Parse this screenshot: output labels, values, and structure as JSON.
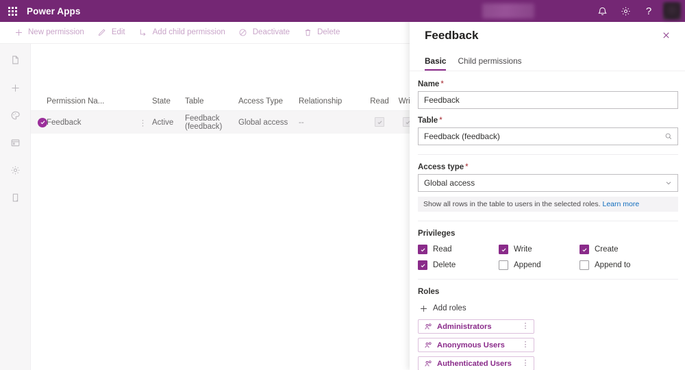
{
  "suite": {
    "waffle_icon": "app-launcher-icon",
    "title": "Power Apps",
    "env_redacted": "",
    "notifications_icon": "bell-icon",
    "settings_icon": "gear-icon",
    "help_label": "?",
    "avatar_icon": "user-avatar"
  },
  "commandbar": {
    "items": [
      {
        "label": "New permission",
        "icon": "plus-icon"
      },
      {
        "label": "Edit",
        "icon": "pencil-icon"
      },
      {
        "label": "Add child permission",
        "icon": "add-child-icon"
      },
      {
        "label": "Deactivate",
        "icon": "block-circle-icon"
      },
      {
        "label": "Delete",
        "icon": "trash-icon"
      }
    ]
  },
  "rail": {
    "items": [
      {
        "icon": "page-icon",
        "name": "pages"
      },
      {
        "icon": "plus-icon",
        "name": "add"
      },
      {
        "icon": "palette-icon",
        "name": "theme"
      },
      {
        "icon": "browser-window-icon",
        "name": "site"
      },
      {
        "icon": "gear-icon",
        "name": "settings"
      },
      {
        "icon": "mobile-device-icon",
        "name": "preview"
      }
    ]
  },
  "grid": {
    "columns": [
      "Permission Na...",
      "State",
      "Table",
      "Access Type",
      "Relationship",
      "Read",
      "Write"
    ],
    "rows": [
      {
        "name": "Feedback",
        "state": "Active",
        "table": "Feedback (feedback)",
        "access_type": "Global access",
        "relationship": "--",
        "read": true,
        "write": true,
        "selected": true,
        "more_icon": "ellipsis-vertical-icon"
      }
    ]
  },
  "panel": {
    "title": "Feedback",
    "close_icon": "close-icon",
    "tabs": [
      {
        "label": "Basic",
        "active": true
      },
      {
        "label": "Child permissions",
        "active": false
      }
    ],
    "fields": {
      "name": {
        "label": "Name",
        "required": "*",
        "value": "Feedback"
      },
      "table": {
        "label": "Table",
        "required": "*",
        "value": "Feedback (feedback)",
        "icon": "search-icon"
      },
      "access_type": {
        "label": "Access type",
        "required": "*",
        "value": "Global access",
        "icon": "chevron-down-icon",
        "options": [
          "Global access"
        ]
      }
    },
    "info": {
      "text": "Show all rows in the table to users in the selected roles.",
      "link": "Learn more"
    },
    "privileges": {
      "title": "Privileges",
      "items": [
        {
          "label": "Read",
          "checked": true
        },
        {
          "label": "Write",
          "checked": true
        },
        {
          "label": "Create",
          "checked": true
        },
        {
          "label": "Delete",
          "checked": true
        },
        {
          "label": "Append",
          "checked": false
        },
        {
          "label": "Append to",
          "checked": false
        }
      ]
    },
    "roles": {
      "title": "Roles",
      "add_label": "Add roles",
      "add_icon": "plus-icon",
      "items": [
        {
          "label": "Administrators",
          "icon": "role-user-icon",
          "more_icon": "ellipsis-vertical-icon"
        },
        {
          "label": "Anonymous Users",
          "icon": "role-user-icon",
          "more_icon": "ellipsis-vertical-icon"
        },
        {
          "label": "Authenticated Users",
          "icon": "role-user-icon",
          "more_icon": "ellipsis-vertical-icon"
        }
      ]
    }
  },
  "colors": {
    "brand_purple": "#742774",
    "accent_purple": "#8a2b8a",
    "link_blue": "#0f6cbd",
    "required_red": "#a4262c",
    "row_selected_bg": "#f6f5f6"
  }
}
